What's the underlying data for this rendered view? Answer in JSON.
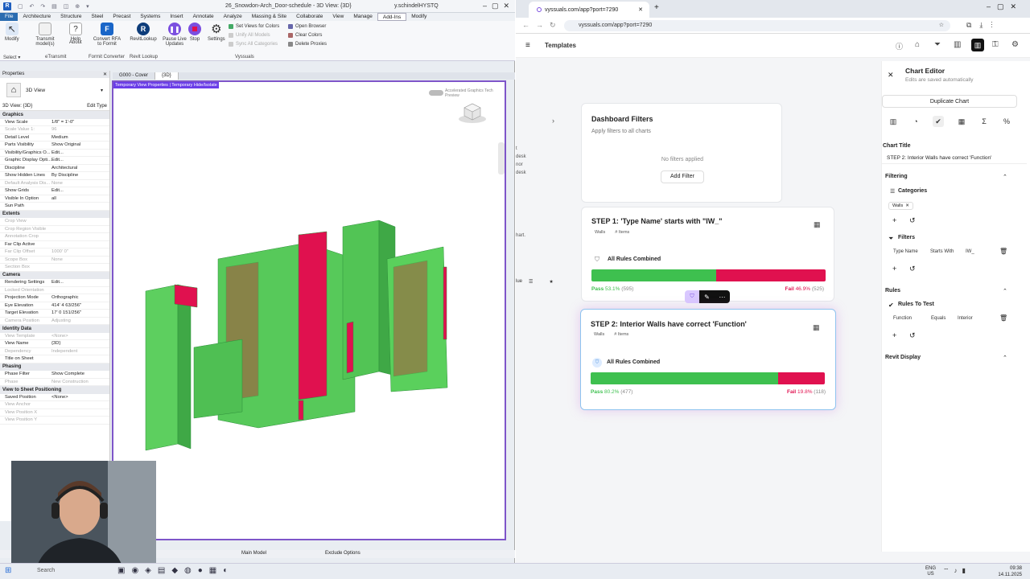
{
  "revit": {
    "title": "26_Snowdon-Arch_Door-schedule - 3D View: {3D}",
    "user": "y.schindelHYSTQ",
    "menu": [
      "File",
      "Architecture",
      "Structure",
      "Steel",
      "Precast",
      "Systems",
      "Insert",
      "Annotate",
      "Analyze",
      "Massing & Site",
      "Collaborate",
      "View",
      "Manage",
      "Add-Ins",
      "Modify"
    ],
    "ribbon": {
      "buttons": [
        "Modify",
        "Transmit model(s)",
        "Help",
        "About",
        "Convert RFA to Formit",
        "RevitLookup",
        "Pause Live Updates",
        "Stop",
        "Settings"
      ],
      "small": [
        "Set Views for Colors",
        "Clear Colors",
        "Delete Proxies",
        "Open Browser",
        "Unify All Models",
        "Sync All Categories"
      ],
      "groups": [
        "Select ▾",
        "eTransmit",
        "Formit Converter",
        "Revit Lookup",
        "Vyssuals"
      ]
    },
    "properties": {
      "header": "Properties",
      "type": "3D View",
      "selector": "3D View: {3D}",
      "edit_type": "Edit Type",
      "rows": [
        {
          "h": "Graphics"
        },
        {
          "k": "View Scale",
          "v": "1/8\" = 1'-0\""
        },
        {
          "k": "Scale Value  1:",
          "v": "96",
          "dim": true
        },
        {
          "k": "Detail Level",
          "v": "Medium"
        },
        {
          "k": "Parts Visibility",
          "v": "Show Original"
        },
        {
          "k": "Visibility/Graphics O...",
          "v": "Edit..."
        },
        {
          "k": "Graphic Display Opti...",
          "v": "Edit..."
        },
        {
          "k": "Discipline",
          "v": "Architectural"
        },
        {
          "k": "Show Hidden Lines",
          "v": "By Discipline"
        },
        {
          "k": "Default Analysis Dis...",
          "v": "None",
          "dim": true
        },
        {
          "k": "Show Grids",
          "v": "Edit..."
        },
        {
          "k": "Visible In Option",
          "v": "all"
        },
        {
          "k": "Sun Path",
          "v": ""
        },
        {
          "h": "Extents"
        },
        {
          "k": "Crop View",
          "v": "",
          "dim": true
        },
        {
          "k": "Crop Region Visible",
          "v": "",
          "dim": true
        },
        {
          "k": "Annotation Crop",
          "v": "",
          "dim": true
        },
        {
          "k": "Far Clip Active",
          "v": ""
        },
        {
          "k": "Far Clip Offset",
          "v": "1000' 0\"",
          "dim": true
        },
        {
          "k": "Scope Box",
          "v": "None",
          "dim": true
        },
        {
          "k": "Section Box",
          "v": "",
          "dim": true
        },
        {
          "h": "Camera"
        },
        {
          "k": "Rendering Settings",
          "v": "Edit..."
        },
        {
          "k": "Locked Orientation",
          "v": "",
          "dim": true
        },
        {
          "k": "Projection Mode",
          "v": "Orthographic"
        },
        {
          "k": "Eye Elevation",
          "v": "414' 4 63/256\""
        },
        {
          "k": "Target Elevation",
          "v": "17' 0 151/256\""
        },
        {
          "k": "Camera Position",
          "v": "Adjusting",
          "dim": true
        },
        {
          "h": "Identity Data"
        },
        {
          "k": "View Template",
          "v": "<None>",
          "dim": true
        },
        {
          "k": "View Name",
          "v": "{3D}"
        },
        {
          "k": "Dependency",
          "v": "Independent",
          "dim": true
        },
        {
          "k": "Title on Sheet",
          "v": ""
        },
        {
          "h": "Phasing"
        },
        {
          "k": "Phase Filter",
          "v": "Show Complete"
        },
        {
          "k": "Phase",
          "v": "New Construction",
          "dim": true
        },
        {
          "h": "View to Sheet Positioning"
        },
        {
          "k": "Saved Position",
          "v": "<None>"
        },
        {
          "k": "View Anchor",
          "v": "",
          "dim": true
        },
        {
          "k": "View Position X",
          "v": "",
          "dim": true
        },
        {
          "k": "View Position Y",
          "v": "",
          "dim": true
        }
      ]
    },
    "view_tabs": [
      "G000 - Cover",
      "{3D}"
    ],
    "temp_banner": "Temporary View Properties | Temporary Hide/Isolate",
    "accel": "Accelerated Graphics Tech Preview",
    "status_model": "Main Model",
    "status_exclude": "Exclude Options"
  },
  "browser": {
    "tab_title": "vyssuals.com/app?port=7290",
    "url": "vyssuals.com/app?port=7290",
    "app": {
      "templates": "Templates",
      "left_fragments": [
        "t",
        "desk",
        "nor",
        "desk",
        "hart."
      ],
      "table_header": "lue",
      "filters_card": {
        "title": "Dashboard Filters",
        "subtitle": "Apply filters to all charts",
        "empty": "No filters applied",
        "add": "Add Filter"
      },
      "step1": {
        "title": "STEP 1: 'Type Name' starts with \"IW_\"",
        "tags": [
          "Walls",
          "# Items"
        ],
        "rule": "All Rules Combined",
        "pass_label": "Pass",
        "pass_pct": "53.1%",
        "pass_count": "(595)",
        "fail_label": "Fail",
        "fail_pct": "46.9%",
        "fail_count": "(525)",
        "pass_fraction": 0.531
      },
      "step2": {
        "title": "STEP 2: Interior Walls have correct 'Function'",
        "tags": [
          "Walls",
          "# Items"
        ],
        "rule": "All Rules Combined",
        "pass_label": "Pass",
        "pass_pct": "80.2%",
        "pass_count": "(477)",
        "fail_label": "Fail",
        "fail_pct": "19.8%",
        "fail_count": "(118)",
        "pass_fraction": 0.802
      },
      "editor": {
        "title": "Chart Editor",
        "subtitle": "Edits are saved automatically",
        "duplicate": "Duplicate Chart",
        "chart_title_label": "Chart Title",
        "chart_title_value": "STEP 2: Interior Walls have correct 'Function'",
        "filtering": "Filtering",
        "categories": "Categories",
        "category_chip": "Walls",
        "filters": "Filters",
        "filter_field": "Type Name",
        "filter_op": "Starts With",
        "filter_value": "IW_",
        "rules": "Rules",
        "rules_to_test": "Rules To Test",
        "rule_field": "Function",
        "rule_op": "Equals",
        "rule_value": "Interior",
        "revit_display": "Revit Display"
      }
    }
  },
  "taskbar": {
    "search": "Search",
    "lang": "ENG",
    "region": "US",
    "time": "09:38",
    "date": "14.11.2025"
  },
  "colors": {
    "pass": "#3ec04f",
    "fail": "#e0114f",
    "revit_accent": "#7e55c9"
  }
}
